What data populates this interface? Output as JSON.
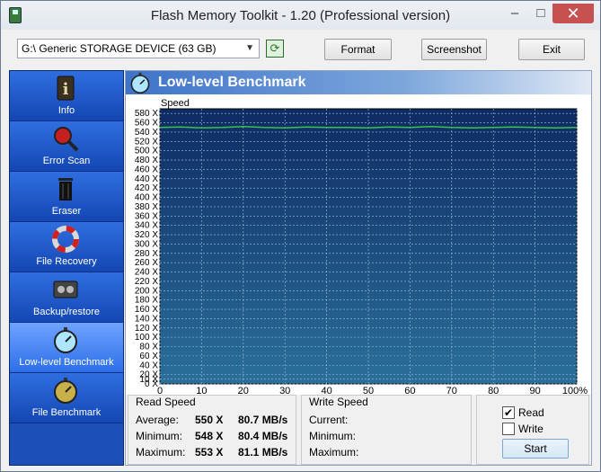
{
  "window": {
    "title": "Flash Memory Toolkit - 1.20 (Professional version)",
    "minimize_glyph": "–",
    "maximize_glyph": "□",
    "close_glyph": "✕"
  },
  "toolbar": {
    "device_value": "G:\\ Generic STORAGE DEVICE (63 GB)",
    "format_label": "Format",
    "screenshot_label": "Screenshot",
    "exit_label": "Exit",
    "refresh_icon": "refresh-icon"
  },
  "sidebar": {
    "items": [
      {
        "label": "Info",
        "icon": "info-icon"
      },
      {
        "label": "Error Scan",
        "icon": "magnifier-icon"
      },
      {
        "label": "Eraser",
        "icon": "trash-icon"
      },
      {
        "label": "File Recovery",
        "icon": "lifebuoy-icon"
      },
      {
        "label": "Backup/restore",
        "icon": "tape-icon"
      },
      {
        "label": "Low-level Benchmark",
        "icon": "stopwatch-icon",
        "active": true
      },
      {
        "label": "File Benchmark",
        "icon": "stopwatch-gold-icon"
      }
    ]
  },
  "panel": {
    "title": "Low-level Benchmark",
    "speed_label": "Speed"
  },
  "chart_data": {
    "type": "line",
    "ylabel": "Speed",
    "yticks": [
      "0 X",
      "10 X",
      "20 X",
      "40 X",
      "60 X",
      "80 X",
      "100 X",
      "120 X",
      "140 X",
      "160 X",
      "180 X",
      "200 X",
      "220 X",
      "240 X",
      "260 X",
      "280 X",
      "300 X",
      "320 X",
      "340 X",
      "360 X",
      "380 X",
      "400 X",
      "420 X",
      "440 X",
      "460 X",
      "480 X",
      "500 X",
      "520 X",
      "540 X",
      "560 X",
      "580 X"
    ],
    "ytick_values": [
      0,
      10,
      20,
      40,
      60,
      80,
      100,
      120,
      140,
      160,
      180,
      200,
      220,
      240,
      260,
      280,
      300,
      320,
      340,
      360,
      380,
      400,
      420,
      440,
      460,
      480,
      500,
      520,
      540,
      560,
      580
    ],
    "xticks": [
      "0",
      "10",
      "20",
      "30",
      "40",
      "50",
      "60",
      "70",
      "80",
      "90",
      "100%"
    ],
    "xlim": [
      0,
      100
    ],
    "ylim": [
      0,
      590
    ],
    "grid": true,
    "series": [
      {
        "name": "Read",
        "color": "#3cc24a",
        "x": [
          0,
          5,
          10,
          15,
          20,
          25,
          30,
          35,
          40,
          45,
          50,
          55,
          60,
          65,
          70,
          75,
          80,
          85,
          90,
          95,
          100
        ],
        "y": [
          550,
          551,
          549,
          550,
          552,
          550,
          549,
          551,
          550,
          550,
          549,
          551,
          550,
          552,
          550,
          549,
          550,
          551,
          550,
          549,
          550
        ]
      }
    ]
  },
  "read_speed": {
    "title": "Read Speed",
    "average_label": "Average:",
    "average_x": "550 X",
    "average_mbs": "80.7 MB/s",
    "minimum_label": "Minimum:",
    "minimum_x": "548 X",
    "minimum_mbs": "80.4 MB/s",
    "maximum_label": "Maximum:",
    "maximum_x": "553 X",
    "maximum_mbs": "81.1 MB/s"
  },
  "write_speed": {
    "title": "Write Speed",
    "current_label": "Current:",
    "minimum_label": "Minimum:",
    "maximum_label": "Maximum:"
  },
  "controls": {
    "read_label": "Read",
    "read_checked": "✔",
    "write_label": "Write",
    "start_label": "Start"
  }
}
